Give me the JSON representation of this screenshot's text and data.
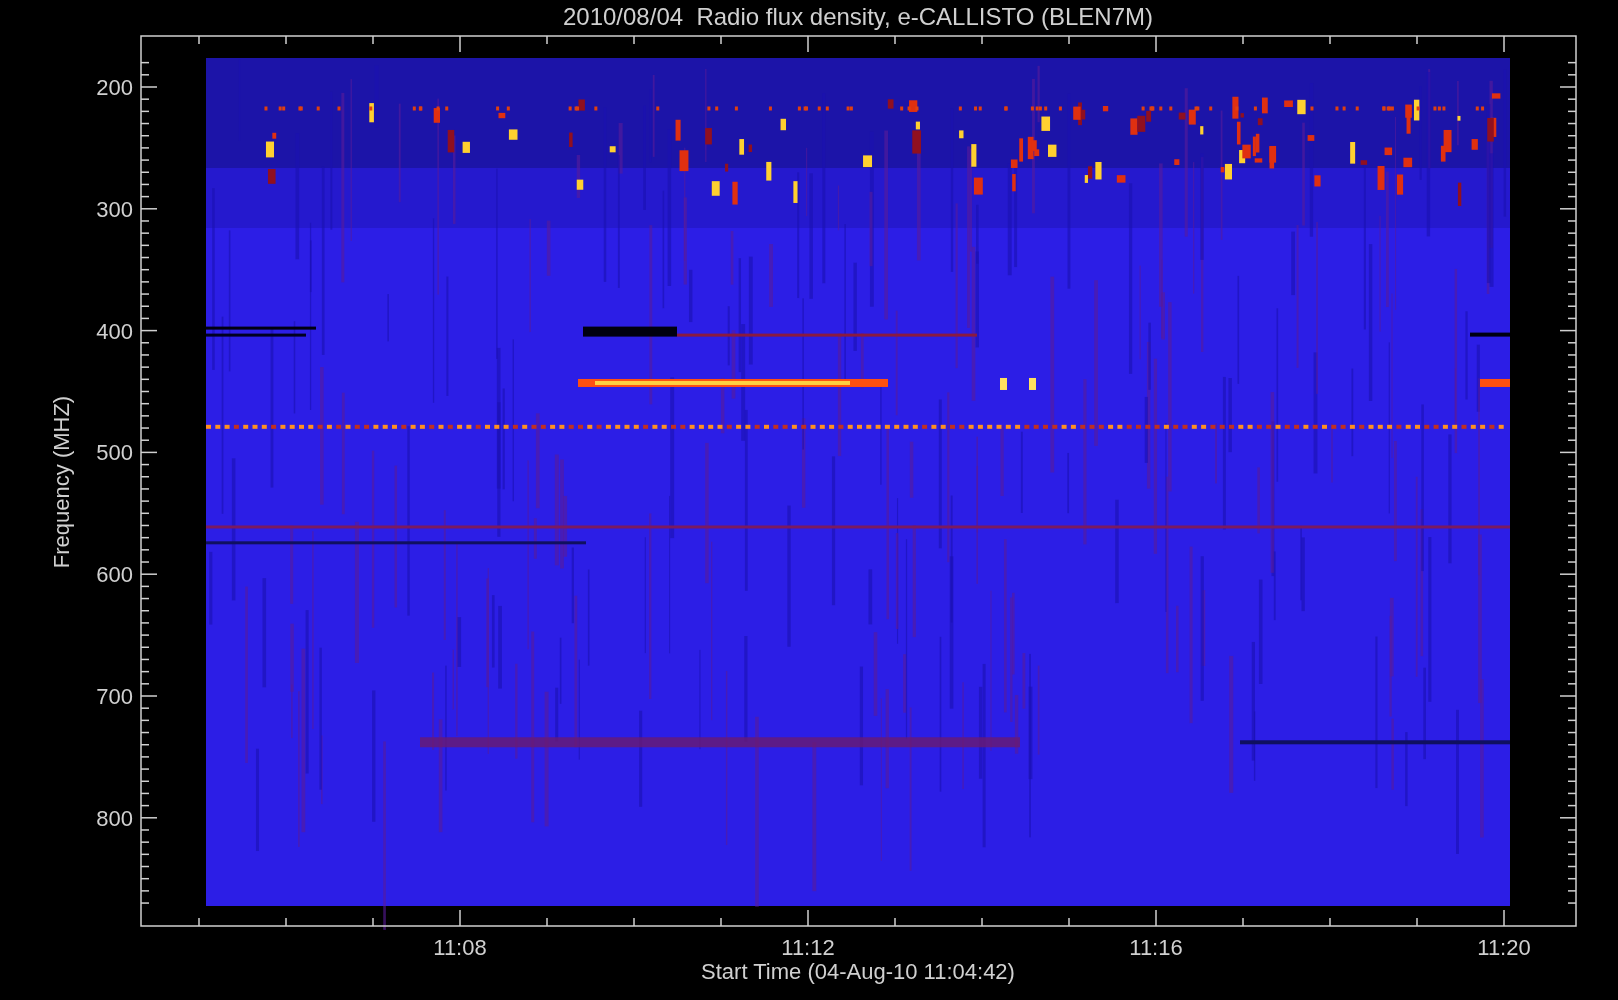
{
  "title": "2010/08/04  Radio flux density, e-CALLISTO (BLEN7M)",
  "y_axis": {
    "label": "Frequency (MHZ)",
    "ticks": [
      "200",
      "300",
      "400",
      "500",
      "600",
      "700",
      "800"
    ]
  },
  "x_axis": {
    "label": "Start Time (04-Aug-10 11:04:42)",
    "ticks": [
      "11:08",
      "11:12",
      "11:16",
      "11:20"
    ]
  }
}
